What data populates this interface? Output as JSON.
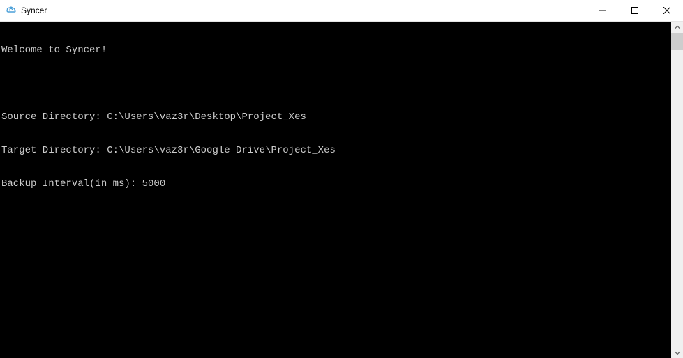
{
  "window": {
    "title": "Syncer",
    "icon": "cloud-sync-icon"
  },
  "terminal": {
    "lines": [
      "Welcome to Syncer!",
      "",
      "Source Directory: C:\\Users\\vaz3r\\Desktop\\Project_Xes",
      "Target Directory: C:\\Users\\vaz3r\\Google Drive\\Project_Xes",
      "Backup Interval(in ms): 5000"
    ]
  }
}
